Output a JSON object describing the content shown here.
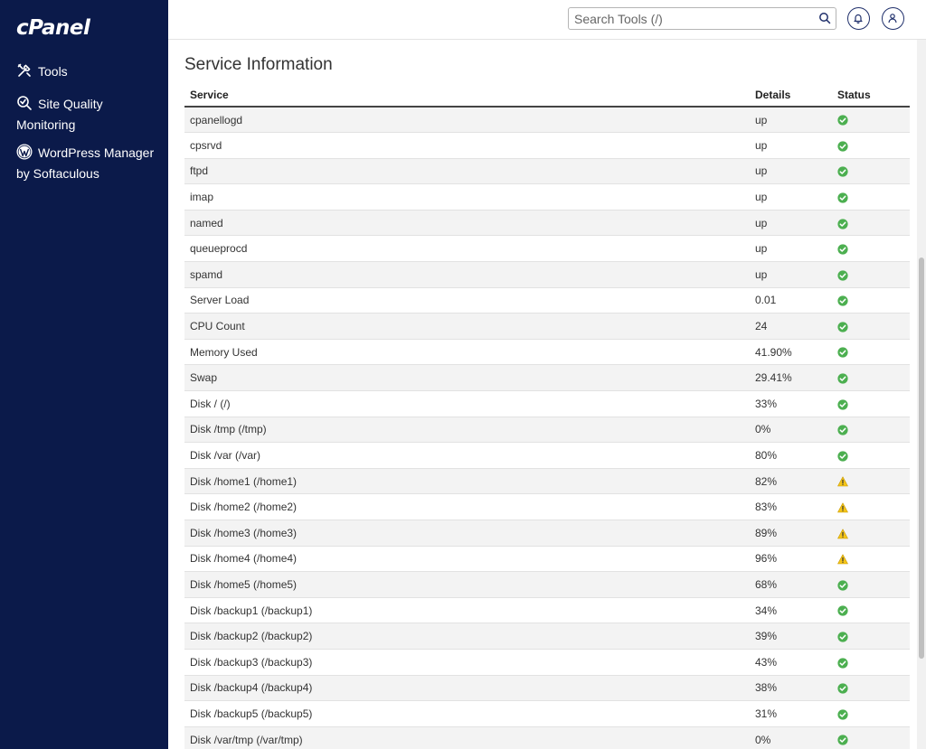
{
  "sidebar": {
    "logo": "cPanel",
    "items": [
      {
        "label": "Tools",
        "icon": "tools-icon"
      },
      {
        "label": "Site Quality Monitoring",
        "line1": "Site Quality",
        "line2": "Monitoring",
        "icon": "site-quality-icon"
      },
      {
        "label": "WordPress Manager by Softaculous",
        "line1": "WordPress Manager",
        "line2": "by Softaculous",
        "icon": "wordpress-icon"
      }
    ]
  },
  "header": {
    "search_placeholder": "Search Tools (/)",
    "search_value": ""
  },
  "main": {
    "title": "Service Information",
    "columns": {
      "service": "Service",
      "details": "Details",
      "status": "Status"
    },
    "rows": [
      {
        "service": "cpanellogd",
        "details": "up",
        "status": "ok"
      },
      {
        "service": "cpsrvd",
        "details": "up",
        "status": "ok"
      },
      {
        "service": "ftpd",
        "details": "up",
        "status": "ok"
      },
      {
        "service": "imap",
        "details": "up",
        "status": "ok"
      },
      {
        "service": "named",
        "details": "up",
        "status": "ok"
      },
      {
        "service": "queueprocd",
        "details": "up",
        "status": "ok"
      },
      {
        "service": "spamd",
        "details": "up",
        "status": "ok"
      },
      {
        "service": "Server Load",
        "details": "0.01",
        "status": "ok"
      },
      {
        "service": "CPU Count",
        "details": "24",
        "status": "ok"
      },
      {
        "service": "Memory Used",
        "details": "41.90%",
        "status": "ok"
      },
      {
        "service": "Swap",
        "details": "29.41%",
        "status": "ok"
      },
      {
        "service": "Disk / (/)",
        "details": "33%",
        "status": "ok"
      },
      {
        "service": "Disk /tmp (/tmp)",
        "details": "0%",
        "status": "ok"
      },
      {
        "service": "Disk /var (/var)",
        "details": "80%",
        "status": "ok"
      },
      {
        "service": "Disk /home1 (/home1)",
        "details": "82%",
        "status": "warning"
      },
      {
        "service": "Disk /home2 (/home2)",
        "details": "83%",
        "status": "warning"
      },
      {
        "service": "Disk /home3 (/home3)",
        "details": "89%",
        "status": "warning"
      },
      {
        "service": "Disk /home4 (/home4)",
        "details": "96%",
        "status": "warning"
      },
      {
        "service": "Disk /home5 (/home5)",
        "details": "68%",
        "status": "ok"
      },
      {
        "service": "Disk /backup1 (/backup1)",
        "details": "34%",
        "status": "ok"
      },
      {
        "service": "Disk /backup2 (/backup2)",
        "details": "39%",
        "status": "ok"
      },
      {
        "service": "Disk /backup3 (/backup3)",
        "details": "43%",
        "status": "ok"
      },
      {
        "service": "Disk /backup4 (/backup4)",
        "details": "38%",
        "status": "ok"
      },
      {
        "service": "Disk /backup5 (/backup5)",
        "details": "31%",
        "status": "ok"
      },
      {
        "service": "Disk /var/tmp (/var/tmp)",
        "details": "0%",
        "status": "ok"
      }
    ]
  },
  "colors": {
    "sidebar_bg": "#0b1a4a",
    "ok": "#4caf50",
    "warning": "#f5c518",
    "header_icon_border": "#1f2f6b"
  }
}
